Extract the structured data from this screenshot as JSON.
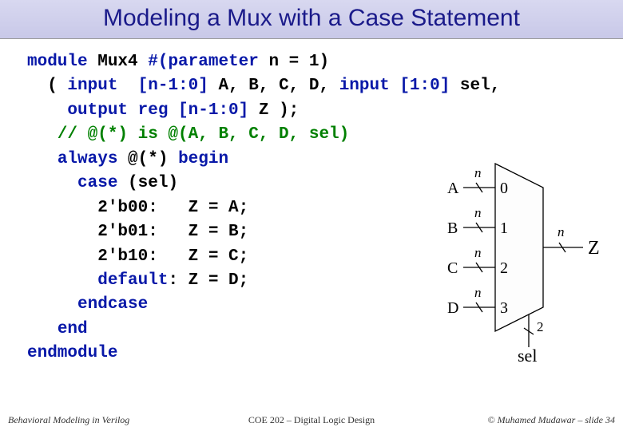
{
  "title": "Modeling a Mux with a Case Statement",
  "code": {
    "l1a": "module",
    "l1b": " Mux4 ",
    "l1c": "#(parameter",
    "l1d": " n = 1)",
    "l2a": "  ( ",
    "l2b": "input  ",
    "l2c": "[n-1:0]",
    "l2d": " A, B, C, D, ",
    "l2e": "input ",
    "l2f": "[1:0]",
    "l2g": " sel,",
    "l3a": "    ",
    "l3b": "output reg ",
    "l3c": "[n-1:0]",
    "l3d": " Z );",
    "l4a": "   // @(*) is @(A, B, C, D, sel)",
    "l5a": "   ",
    "l5b": "always",
    "l5c": " @(*) ",
    "l5d": "begin",
    "l6a": "     ",
    "l6b": "case",
    "l6c": " (sel)",
    "l7": "       2'b00:   Z = A;",
    "l8": "       2'b01:   Z = B;",
    "l9": "       2'b10:   Z = C;",
    "l10a": "       ",
    "l10b": "default",
    "l10c": ": Z = D;",
    "l11a": "     ",
    "l11b": "endcase",
    "l12a": "   ",
    "l12b": "end",
    "l13": "endmodule"
  },
  "diagram": {
    "inA": "A",
    "inB": "B",
    "inC": "C",
    "inD": "D",
    "p0": "0",
    "p1": "1",
    "p2": "2",
    "p3": "3",
    "n": "n",
    "two": "2",
    "out": "Z",
    "sel": "sel"
  },
  "footer": {
    "left": "Behavioral Modeling in Verilog",
    "center": "COE 202 – Digital Logic Design",
    "right": "© Muhamed Mudawar – slide 34"
  }
}
